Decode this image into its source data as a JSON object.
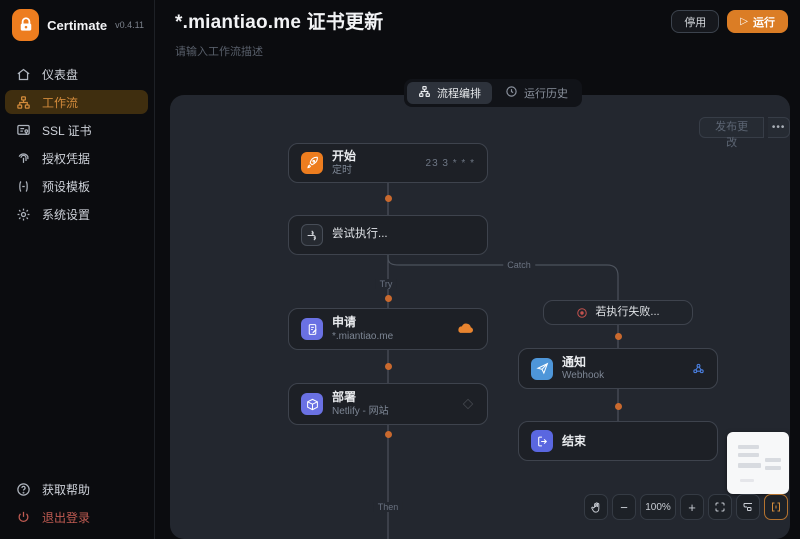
{
  "app": {
    "name": "Certimate",
    "version": "v0.4.11"
  },
  "sidebar": {
    "items": [
      {
        "label": "仪表盘",
        "icon": "dashboard-icon",
        "active": false
      },
      {
        "label": "工作流",
        "icon": "workflow-icon",
        "active": true
      },
      {
        "label": "SSL 证书",
        "icon": "certificate-icon",
        "active": false
      },
      {
        "label": "授权凭据",
        "icon": "credentials-icon",
        "active": false
      },
      {
        "label": "预设模板",
        "icon": "template-icon",
        "active": false
      },
      {
        "label": "系统设置",
        "icon": "settings-icon",
        "active": false
      }
    ],
    "footer": [
      {
        "label": "获取帮助",
        "icon": "help-icon"
      },
      {
        "label": "退出登录",
        "icon": "logout-icon",
        "danger": true
      }
    ]
  },
  "header": {
    "title": "*.miantiao.me 证书更新",
    "description": "请输入工作流描述",
    "buttons": {
      "disable": "停用",
      "run": "运行",
      "run_icon": "play-icon"
    }
  },
  "tabs": [
    {
      "label": "流程编排",
      "icon": "flow-icon",
      "active": true
    },
    {
      "label": "运行历史",
      "icon": "history-icon",
      "active": false
    }
  ],
  "canvas": {
    "publish_button": "发布更改",
    "more_button": "•••",
    "branch_labels": {
      "try": "Try",
      "catch": "Catch",
      "then": "Then"
    },
    "nodes": {
      "start": {
        "title": "开始",
        "subtitle": "定时",
        "meta": "23 3 * * *",
        "icon": "rocket-icon",
        "icon_color": "#ed7d1f"
      },
      "try_block": {
        "title": "尝试执行...",
        "icon": "split-icon"
      },
      "apply": {
        "title": "申请",
        "subtitle": "*.miantiao.me",
        "icon": "scroll-pen-icon",
        "icon_color": "#6a71e3",
        "provider_icon": "cloudflare-icon"
      },
      "deploy": {
        "title": "部署",
        "subtitle": "Netlify - 网站",
        "icon": "cube-icon",
        "icon_color": "#6a71e3"
      },
      "on_failure": {
        "title": "若执行失败...",
        "icon": "record-icon",
        "icon_color": "#c4524e"
      },
      "notify": {
        "title": "通知",
        "subtitle": "Webhook",
        "icon": "paper-plane-icon",
        "icon_color": "#4e96d9",
        "provider_icon": "webhook-icon"
      },
      "end": {
        "title": "结束",
        "icon": "exit-icon",
        "icon_color": "#5a67e0"
      }
    },
    "controls": {
      "zoom_level": "100%"
    }
  },
  "colors": {
    "accent": "#ed7d1f",
    "dot": "#c9692e",
    "active_item_bg": "#3f2e0f",
    "canvas_bg": "#23272f",
    "danger": "#c05b52"
  }
}
